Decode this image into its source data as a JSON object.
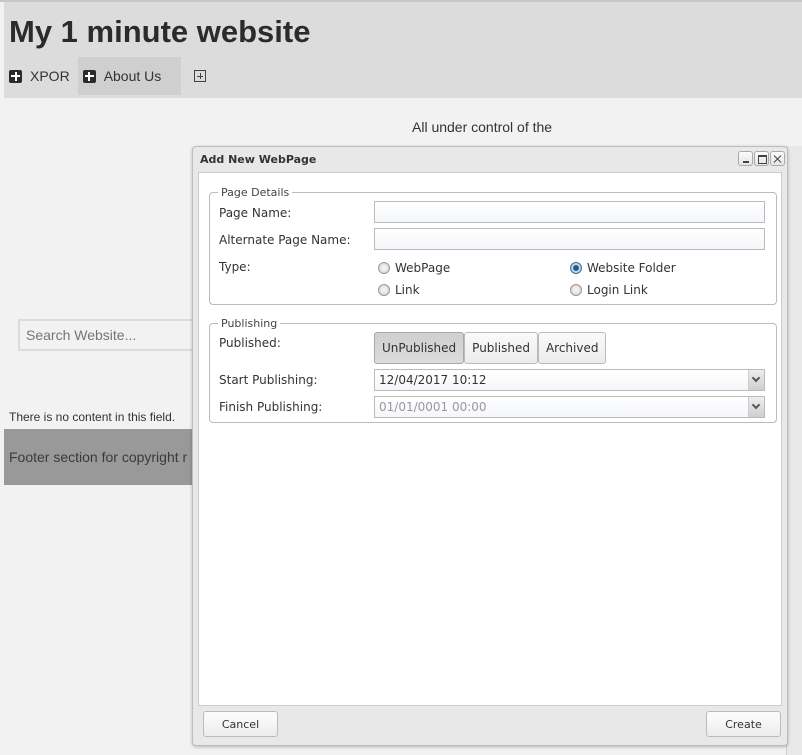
{
  "site": {
    "title": "My 1 minute website",
    "nav": [
      {
        "label": "XPOR",
        "icon": "plus-square-icon"
      },
      {
        "label": "About Us",
        "icon": "plus-square-icon"
      }
    ],
    "nav_add_icon": "plus-square-outline-icon",
    "tagline": "All under control of the",
    "search_placeholder": "Search Website...",
    "no_content": "There is no content in this field.",
    "footer": "Footer section for copyright r"
  },
  "dialog": {
    "title": "Add New WebPage",
    "window_buttons": [
      "minimize-icon",
      "maximize-icon",
      "close-icon"
    ],
    "page_details": {
      "legend": "Page Details",
      "page_name_label": "Page Name:",
      "page_name_value": "",
      "alt_name_label": "Alternate Page Name:",
      "alt_name_value": "",
      "type_label": "Type:",
      "type_options": [
        {
          "label": "WebPage",
          "checked": false
        },
        {
          "label": "Website Folder",
          "checked": true
        },
        {
          "label": "Link",
          "checked": false
        },
        {
          "label": "Login Link",
          "checked": false
        }
      ]
    },
    "publishing": {
      "legend": "Publishing",
      "published_label": "Published:",
      "states": [
        "UnPublished",
        "Published",
        "Archived"
      ],
      "selected_state": "UnPublished",
      "start_label": "Start Publishing:",
      "start_value": "12/04/2017 10:12",
      "finish_label": "Finish Publishing:",
      "finish_value": "01/01/0001 00:00"
    },
    "cancel_label": "Cancel",
    "create_label": "Create"
  }
}
